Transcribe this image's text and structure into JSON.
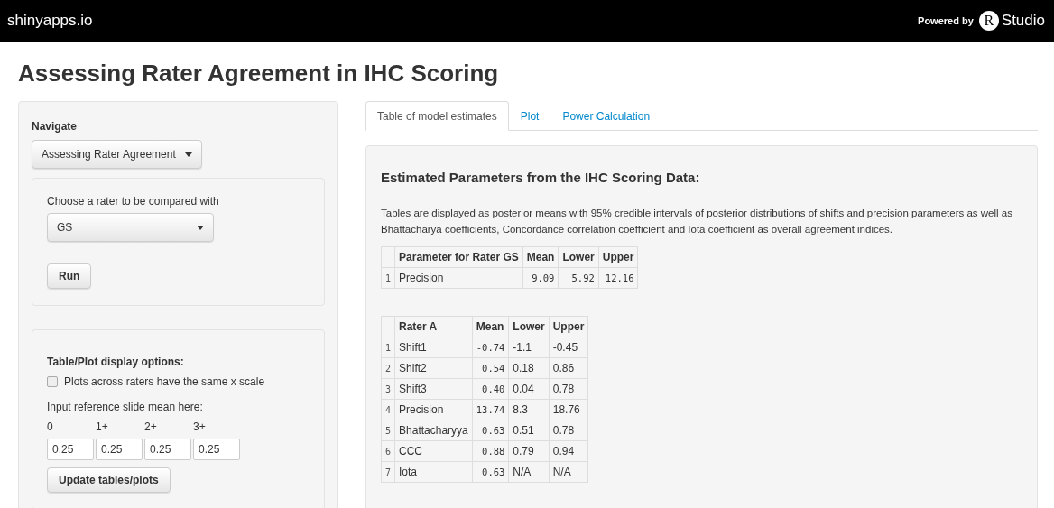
{
  "navbar": {
    "brand": "shinyapps.io",
    "powered_by": "Powered by",
    "logo_letter": "R",
    "logo_text": "Studio"
  },
  "title": "Assessing Rater Agreement in IHC Scoring",
  "sidebar": {
    "navigate_label": "Navigate",
    "navigate_value": "Assessing Rater Agreement",
    "rater_label": "Choose a rater to be compared with",
    "rater_value": "GS",
    "run_button": "Run",
    "options_title": "Table/Plot display options:",
    "checkbox": {
      "label": "Plots across raters have the same x scale",
      "checked": false
    },
    "reference_label": "Input reference slide mean here:",
    "reference_inputs": [
      {
        "label": "0",
        "value": "0.25"
      },
      {
        "label": "1+",
        "value": "0.25"
      },
      {
        "label": "2+",
        "value": "0.25"
      },
      {
        "label": "3+",
        "value": "0.25"
      }
    ],
    "update_button": "Update tables/plots"
  },
  "tabs": [
    {
      "label": "Table of model estimates",
      "selected": true
    },
    {
      "label": "Plot",
      "selected": false
    },
    {
      "label": "Power Calculation",
      "selected": false
    }
  ],
  "panel": {
    "heading": "Estimated Parameters from the IHC Scoring Data:",
    "description": "Tables are displayed as posterior means with 95% credible intervals of posterior distributions of shifts and precision parameters as well as Bhattacharya coefficients, Concordance correlation coefficient and Iota coefficient as overall agreement indices.",
    "tables": [
      {
        "columns": [
          {
            "label": "Parameter for Rater GS",
            "kind": "text"
          },
          {
            "label": "Mean",
            "kind": "numeric"
          },
          {
            "label": "Lower",
            "kind": "numeric"
          },
          {
            "label": "Upper",
            "kind": "numeric"
          }
        ],
        "rows": [
          {
            "index": "1",
            "cells": [
              "Precision",
              "9.09",
              "5.92",
              "12.16"
            ]
          }
        ]
      },
      {
        "columns": [
          {
            "label": "Rater A",
            "kind": "text"
          },
          {
            "label": "Mean",
            "kind": "numeric"
          },
          {
            "label": "Lower",
            "kind": "text"
          },
          {
            "label": "Upper",
            "kind": "text"
          }
        ],
        "rows": [
          {
            "index": "1",
            "cells": [
              "Shift1",
              "-0.74",
              "-1.1",
              "-0.45"
            ]
          },
          {
            "index": "2",
            "cells": [
              "Shift2",
              "0.54",
              "0.18",
              "0.86"
            ]
          },
          {
            "index": "3",
            "cells": [
              "Shift3",
              "0.40",
              "0.04",
              "0.78"
            ]
          },
          {
            "index": "4",
            "cells": [
              "Precision",
              "13.74",
              "8.3",
              "18.76"
            ]
          },
          {
            "index": "5",
            "cells": [
              "Bhattacharyya",
              "0.63",
              "0.51",
              "0.78"
            ]
          },
          {
            "index": "6",
            "cells": [
              "CCC",
              "0.88",
              "0.79",
              "0.94"
            ]
          },
          {
            "index": "7",
            "cells": [
              "Iota",
              "0.63",
              "N/A",
              "N/A"
            ]
          }
        ]
      }
    ]
  }
}
